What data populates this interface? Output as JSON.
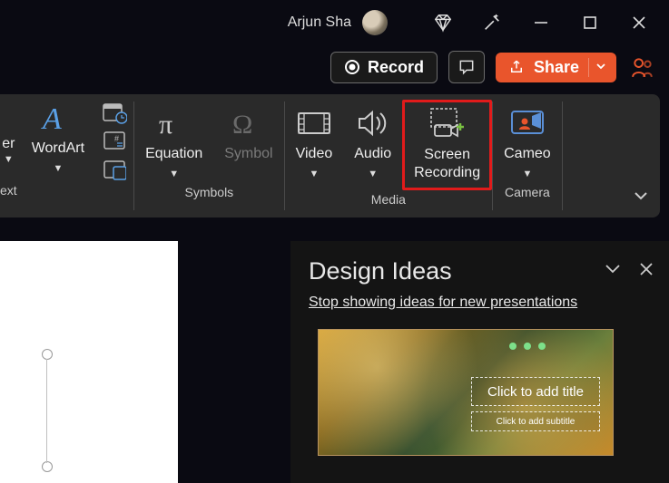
{
  "titlebar": {
    "user_name": "Arjun Sha"
  },
  "actionbar": {
    "record_label": "Record",
    "share_label": "Share"
  },
  "ribbon": {
    "partial_left": {
      "label1": "er",
      "label2": "ext"
    },
    "wordart_label": "WordArt",
    "symbols": {
      "group_label": "Symbols",
      "equation_label": "Equation",
      "symbol_label": "Symbol"
    },
    "media": {
      "group_label": "Media",
      "video_label": "Video",
      "audio_label": "Audio",
      "screenrec_label": "Screen\nRecording"
    },
    "camera": {
      "group_label": "Camera",
      "cameo_label": "Cameo"
    }
  },
  "design_pane": {
    "title": "Design Ideas",
    "stop_link": "Stop showing ideas for new presentations",
    "thumb_title": "Click to add title",
    "thumb_sub": "Click to add subtitle"
  }
}
